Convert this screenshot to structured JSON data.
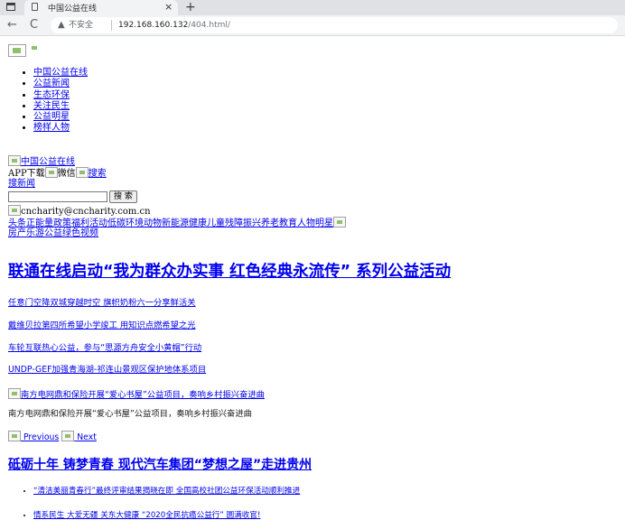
{
  "browser": {
    "tab_title": "中国公益在线",
    "close_glyph": "×",
    "newtab_glyph": "+",
    "back_glyph": "←",
    "reload_glyph": "C",
    "security_text": "不安全",
    "url_host": "192.168.160.132",
    "url_path": "/404.html/"
  },
  "nav": {
    "items": [
      "中国公益在线",
      "公益新闻",
      "生态环保",
      "关注民生",
      "公益明星",
      "榜样人物"
    ]
  },
  "header": {
    "logo_alt": "中国公益在线",
    "app_text": "APP下载",
    "wechat_alt": "微信",
    "search_alt": "搜索",
    "search_news_link": "搜新闻",
    "search_button": "搜 索",
    "email_alt": "cncharity@cncharity.com.cn"
  },
  "category_links": {
    "row1": "头条正能量政策福利活动低碳环境动物新能源健康儿童残障振兴养老教育人物明星",
    "row2": "房产乐游公益绿色视频"
  },
  "main_headline": "联通在线启动“我为群众办实事 红色经典永流传” 系列公益活动",
  "news": [
    "任意门空降双城穿越时空 旗帜奶粉六一分享鲜活关",
    "戴维贝拉第四所希望小学竣工 用知识点燃希望之光",
    "车轮互联热心公益，参与“思源方舟安全小黄帽”行动",
    "UNDP-GEF加强青海湖-祁连山景观区保护地体系项目"
  ],
  "slider": {
    "image_alt": "南方电网鼎和保险开展“爱心书屋”公益项目，奏响乡村振兴奋进曲",
    "caption": "南方电网鼎和保险开展“爱心书屋”公益项目，奏响乡村振兴奋进曲",
    "previous": "Previous",
    "next": "Next"
  },
  "second_headline": "砥砺十年 铸梦青春 现代汽车集团“梦想之屋”走进贵州",
  "bottom_list": [
    "“清洁美丽青春行”最终评审结果揭晓在即 全国高校社团公益环保活动顺利推进",
    "情系民生 大爱无疆 关东大健康 “2020全民抗癌公益行” 圆满收官!"
  ]
}
